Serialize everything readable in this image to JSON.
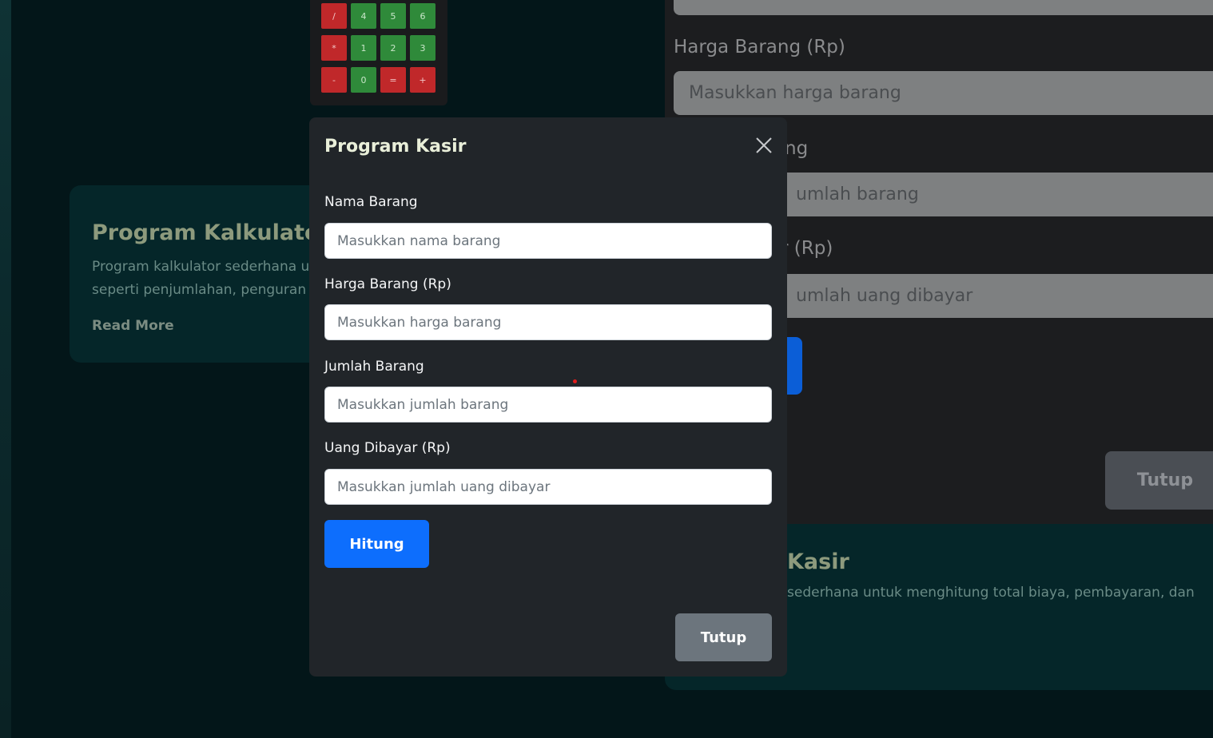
{
  "calculator": {
    "keys": [
      {
        "label": "/",
        "kind": "red"
      },
      {
        "label": "4",
        "kind": "green"
      },
      {
        "label": "5",
        "kind": "green"
      },
      {
        "label": "6",
        "kind": "green"
      },
      {
        "label": "*",
        "kind": "red"
      },
      {
        "label": "1",
        "kind": "green"
      },
      {
        "label": "2",
        "kind": "green"
      },
      {
        "label": "3",
        "kind": "green"
      },
      {
        "label": "-",
        "kind": "red"
      },
      {
        "label": "0",
        "kind": "green"
      },
      {
        "label": "=",
        "kind": "red"
      },
      {
        "label": "+",
        "kind": "red"
      }
    ]
  },
  "card_kalkulator": {
    "title": "Program Kalkulator",
    "description_line1": "Program kalkulator sederhana u",
    "description_line2": "seperti penjumlahan, penguran",
    "read_more": "Read More"
  },
  "background_modal": {
    "harga_label": "Harga Barang (Rp)",
    "harga_placeholder": "Masukkan harga barang",
    "jumlah_label_partial": "ng",
    "jumlah_placeholder_partial": "umlah barang",
    "uang_label_partial": "r (Rp)",
    "uang_placeholder_partial": "umlah uang dibayar",
    "tutup_label": "Tutup"
  },
  "card_kasir": {
    "title_partial": "Kasir",
    "description_partial": "sederhana untuk menghitung total biaya, pembayaran, dan"
  },
  "modal": {
    "title": "Program Kasir",
    "fields": {
      "nama": {
        "label": "Nama Barang",
        "placeholder": "Masukkan nama barang"
      },
      "harga": {
        "label": "Harga Barang (Rp)",
        "placeholder": "Masukkan harga barang"
      },
      "jumlah": {
        "label": "Jumlah Barang",
        "placeholder": "Masukkan jumlah barang"
      },
      "uang": {
        "label": "Uang Dibayar (Rp)",
        "placeholder": "Masukkan jumlah uang dibayar"
      }
    },
    "hitung_label": "Hitung",
    "tutup_label": "Tutup"
  },
  "colors": {
    "primary_button": "#0d6efd",
    "secondary_button": "#6c757d",
    "modal_bg": "#212529"
  }
}
